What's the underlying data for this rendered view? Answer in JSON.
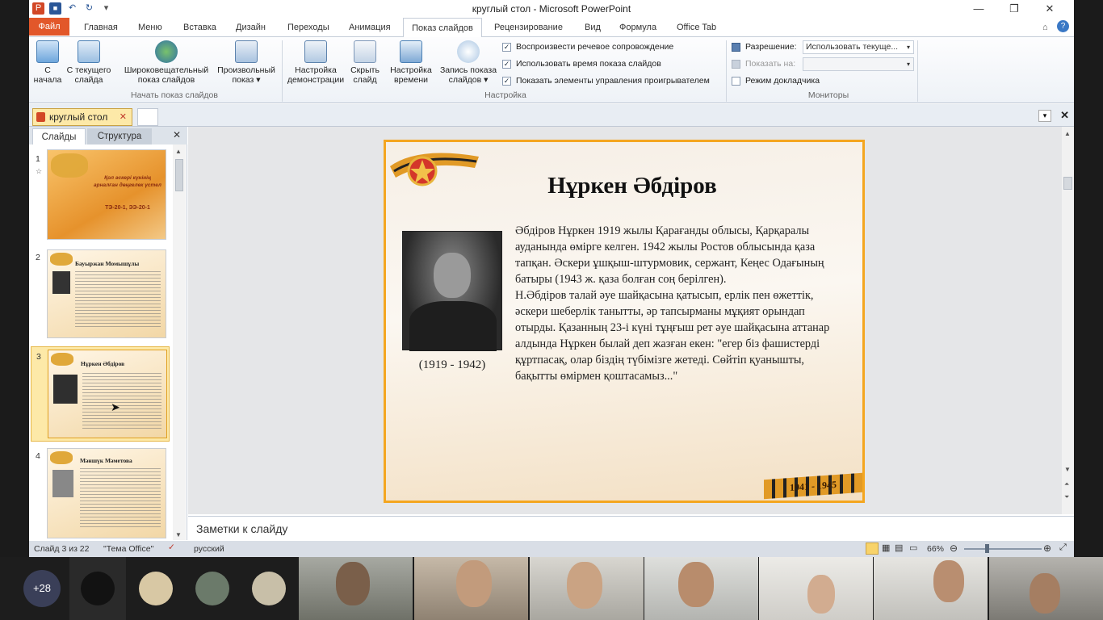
{
  "app": {
    "title": "круглый стол - Microsoft PowerPoint"
  },
  "qat": [
    {
      "name": "ppt-logo-icon",
      "glyph": "P",
      "color": "#d24726"
    },
    {
      "name": "save-icon",
      "glyph": "■",
      "color": "#2b5797"
    },
    {
      "name": "undo-icon",
      "glyph": "↶",
      "color": "#2b5797"
    },
    {
      "name": "redo-icon",
      "glyph": "↻",
      "color": "#2b5797"
    }
  ],
  "tabs": {
    "file": "Файл",
    "home": "Главная",
    "menu": "Меню",
    "insert": "Вставка",
    "design": "Дизайн",
    "transitions": "Переходы",
    "animation": "Анимация",
    "slideshow": "Показ слайдов",
    "review": "Рецензирование",
    "view": "Вид",
    "formula": "Формула",
    "officetab": "Office Tab"
  },
  "ribbon": {
    "from_start": "С\nначала",
    "from_current": "С текущего\nслайда",
    "broadcast": "Широковещательный\nпоказ слайдов",
    "custom": "Произвольный\nпоказ ▾",
    "group_start": "Начать показ слайдов",
    "setup": "Настройка\nдемонстрации",
    "hide": "Скрыть\nслайд",
    "rehearse": "Настройка\nвремени",
    "record": "Запись показа\nслайдов ▾",
    "chk_narration": "Воспроизвести речевое сопровождение",
    "chk_timings": "Использовать время показа слайдов",
    "chk_media": "Показать элементы управления проигрывателем",
    "group_setup": "Настройка",
    "resolution_label": "Разрешение:",
    "resolution_value": "Использовать текуще...",
    "show_on_label": "Показать на:",
    "presenter": "Режим докладчика",
    "group_monitors": "Мониторы"
  },
  "doc": {
    "tab_name": "круглый стол"
  },
  "panel": {
    "tab_slides": "Слайды",
    "tab_outline": "Структура",
    "thumbs": [
      {
        "num": "1",
        "title": "Қол әскері күнінің арналған дөңгелек үстел",
        "sub": "ТЭ-20-1, ЭЭ-20-1"
      },
      {
        "num": "2",
        "title": "Бауыржан Момышұлы"
      },
      {
        "num": "3",
        "title": "Нұркен Әбдіров"
      },
      {
        "num": "4",
        "title": "Мәншүк Мәметова"
      }
    ]
  },
  "slide": {
    "title": "Нұркен Әбдіров",
    "years": "(1919 - 1942)",
    "body": "Әбдіров Нұркен 1919 жылы Қарағанды облысы, Қарқаралы ауданында өмірге келген. 1942 жылы Ростов облысында қаза тапқан. Әскери ұшқыш-штурмовик, сержант, Кеңес Одағының батыры (1943 ж. қаза болған соң берілген).\nН.Әбдіров талай әуе шайқасына қатысып, ерлік пен өжеттік, әскери шеберлік танытты, әр тапсырманы мұқият орындап отырды. Қазанның 23-і күні тұңғыш рет әуе шайқасына аттанар алдында Нұркен былай деп жазған екен: \"егер біз фашистерді құртпасақ, олар біздің түбімізге жетеді. Сөйтіп қуанышты, бақытты өмірмен қоштасамыз...\"",
    "ribbon_text": "1941 - 1945"
  },
  "notes": "Заметки к слайду",
  "status": {
    "slide_of": "Слайд 3 из 22",
    "theme": "\"Тема Office\"",
    "language": "русский",
    "zoom": "66%"
  },
  "zoom": {
    "participants_more": "+28"
  },
  "colors": {
    "file_tab": "#e2572a",
    "slide_border": "#f4a620",
    "selected_thumb": "#fde9a8"
  }
}
